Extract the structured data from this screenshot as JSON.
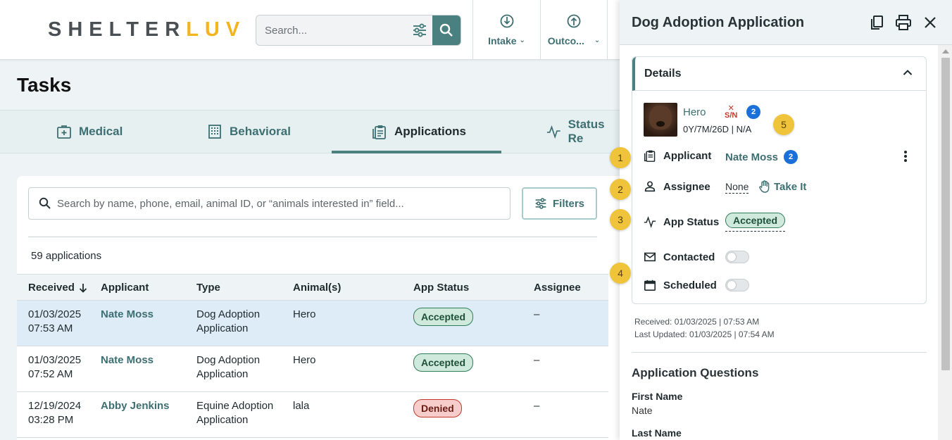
{
  "header": {
    "logo_part1": "SHELTER",
    "logo_part2": "LUV",
    "search_placeholder": "Search...",
    "nav": [
      {
        "label": "Intake",
        "icon": "intake-icon"
      },
      {
        "label": "Outco...",
        "icon": "outcome-icon"
      }
    ]
  },
  "page": {
    "title": "Tasks"
  },
  "tabs": [
    {
      "label": "Medical",
      "icon": "medical-icon"
    },
    {
      "label": "Behavioral",
      "icon": "behavioral-icon"
    },
    {
      "label": "Applications",
      "icon": "applications-icon",
      "active": true
    },
    {
      "label": "Status Re",
      "icon": "status-icon"
    }
  ],
  "list": {
    "search_placeholder": "Search by name, phone, email, animal ID, or “animals interested in” field...",
    "filters_label": "Filters",
    "count_text": "59 applications",
    "columns": [
      "Received",
      "Applicant",
      "Type",
      "Animal(s)",
      "App Status",
      "Assignee"
    ],
    "rows": [
      {
        "date": "01/03/2025",
        "time": "07:53 AM",
        "applicant": "Nate Moss",
        "type1": "Dog Adoption",
        "type2": "Application",
        "animal": "Hero",
        "status": "Accepted",
        "assignee": "–"
      },
      {
        "date": "01/03/2025",
        "time": "07:52 AM",
        "applicant": "Nate Moss",
        "type1": "Dog Adoption",
        "type2": "Application",
        "animal": "Hero",
        "status": "Accepted",
        "assignee": "–"
      },
      {
        "date": "12/19/2024",
        "time": "03:28 PM",
        "applicant": "Abby Jenkins",
        "type1": "Equine Adoption",
        "type2": "Application",
        "animal": "lala",
        "status": "Denied",
        "assignee": "–"
      }
    ]
  },
  "panel": {
    "title": "Dog Adoption Application",
    "details_title": "Details",
    "animal": {
      "name": "Hero",
      "sn_top": "✕",
      "sn_text": "S/N",
      "badge": "2",
      "age": "0Y/7M/26D | N/A"
    },
    "applicant_label": "Applicant",
    "applicant_value": "Nate Moss",
    "applicant_badge": "2",
    "assignee_label": "Assignee",
    "assignee_value": "None",
    "take_it": "Take It",
    "status_label": "App Status",
    "status_value": "Accepted",
    "contacted_label": "Contacted",
    "scheduled_label": "Scheduled",
    "received": "Received: 01/03/2025 | 07:53 AM",
    "updated": "Last Updated: 01/03/2025 | 07:54 AM",
    "questions_title": "Application Questions",
    "questions": [
      {
        "label": "First Name",
        "value": "Nate"
      },
      {
        "label": "Last Name",
        "value": ""
      }
    ]
  },
  "markers": [
    "1",
    "2",
    "3",
    "4",
    "5"
  ]
}
